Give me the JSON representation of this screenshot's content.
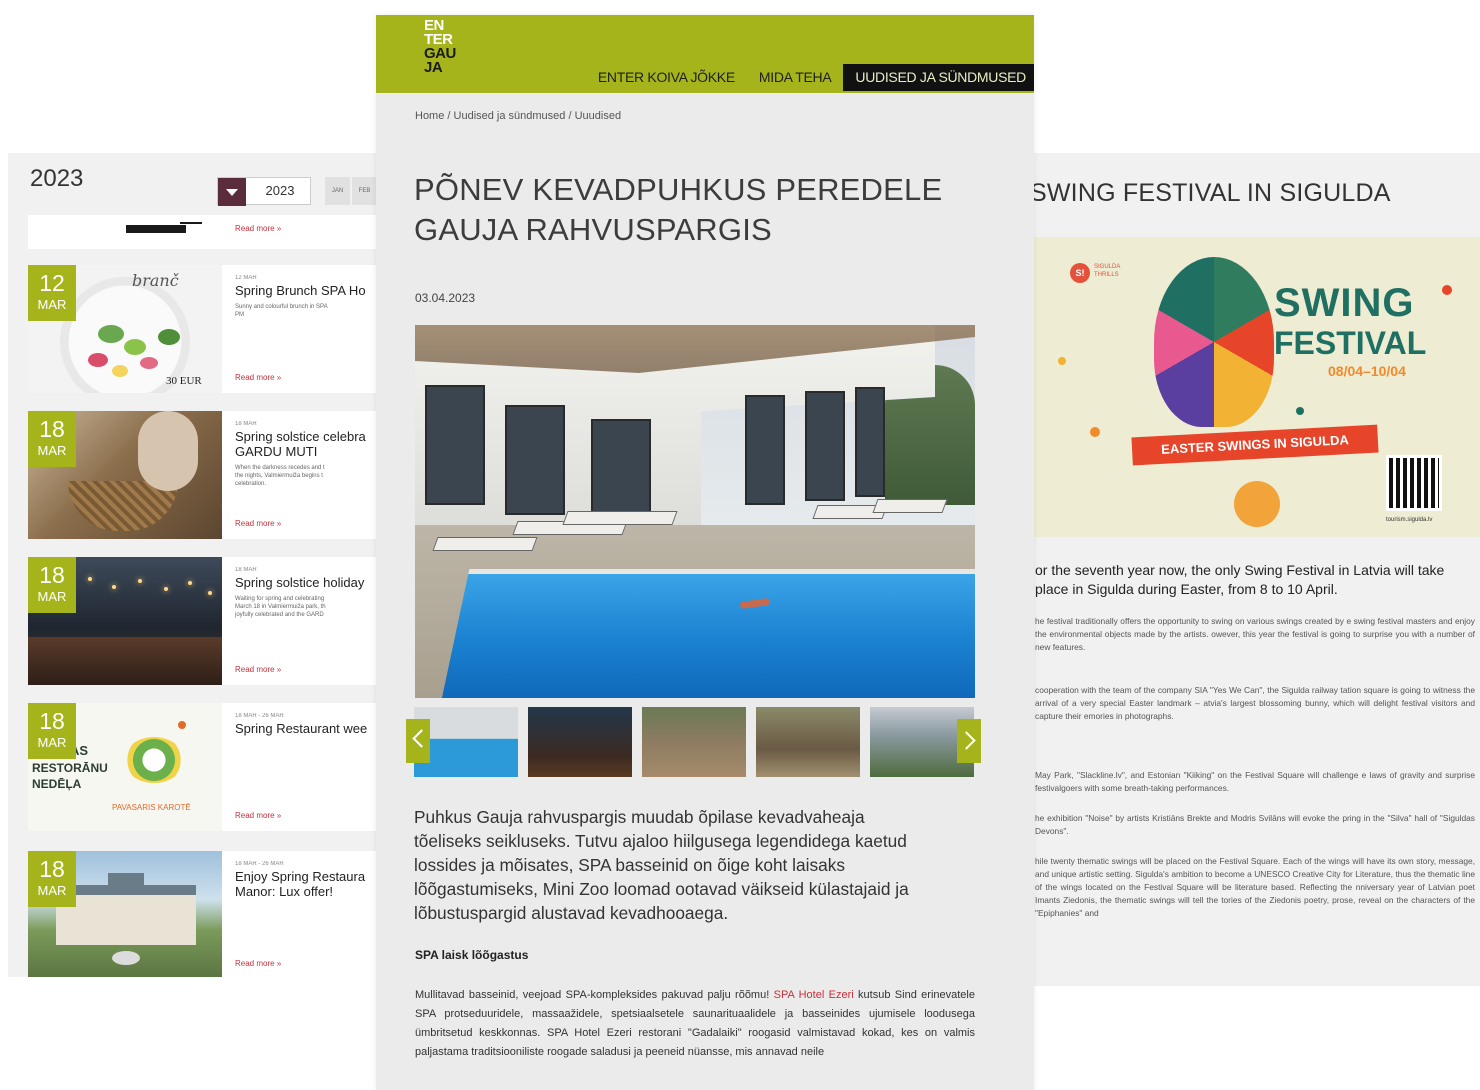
{
  "left": {
    "year_title": "2023",
    "year_select_value": "2023",
    "months": [
      "JAN",
      "FEB"
    ],
    "top_read_more": "Read more »",
    "events": [
      {
        "day": "12",
        "month": "MAR",
        "small_date": "12 MAR",
        "title": "Spring Brunch SPA Ho",
        "desc": "Sunny and colourful brunch in SPA",
        "desc2": "PM",
        "desc3": "",
        "read_more": "Read more »",
        "img_text": "branč",
        "price": "30 EUR"
      },
      {
        "day": "18",
        "month": "MAR",
        "small_date": "18 MAR",
        "title": "Spring solstice celebra",
        "title2": "GARDU MUTI",
        "desc": "When the darkness recedes and t",
        "desc2": "the nights, Valmiermuiža begins t",
        "desc3": "celebration.",
        "read_more": "Read more »"
      },
      {
        "day": "18",
        "month": "MAR",
        "small_date": "18 MAR",
        "title": "Spring solstice holiday",
        "desc": "Waiting for spring and celebrating",
        "desc2": "March 18 in Valmiermuiža park, th",
        "desc3": "joyfully celebrated and the GARD",
        "read_more": "Read more »"
      },
      {
        "day": "18",
        "month": "MAR",
        "small_date": "18 MAR - 26 MAR",
        "title": "Spring Restaurant wee",
        "desc": "",
        "desc2": "",
        "desc3": "",
        "read_more": "Read more »",
        "img_line1": "AS",
        "img_line2": "RESTORĀNU",
        "img_line3": "NEDĒĻA",
        "img_line4": "PAVASARIS KAROTĒ"
      },
      {
        "day": "18",
        "month": "MAR",
        "small_date": "18 MAR - 26 MAR",
        "title": "Enjoy Spring Restaura",
        "title2": "Manor: Lux offer!",
        "desc": "",
        "desc2": "",
        "desc3": "",
        "read_more": "Read more »"
      }
    ]
  },
  "center": {
    "logo_lines": [
      "EN",
      "TER",
      "GAU",
      "JA"
    ],
    "nav": [
      "ENTER KOIVA JÕKKE",
      "MIDA TEHA",
      "UUDISED JA SÜNDMUSED"
    ],
    "breadcrumb": "Home / Uudised ja sündmused / Uuudised",
    "title": "PÕNEV KEVADPUHKUS PEREDELE GAUJA RAHVUSPARGIS",
    "date": "03.04.2023",
    "lead": "Puhkus Gauja rahvuspargis muudab õpilase kevadvaheaja tõeliseks seikluseks. Tutvu ajaloo hiilgusega legendidega kaetud lossides ja mõisates, SPA basseinid on õige koht laisaks lõõgastumiseks, Mini Zoo loomad ootavad väikseid külastajaid ja lõbustuspargid alustavad kevadhooaega.",
    "subhead": "SPA laisk lõõgastus",
    "body_pre": "Mullitavad basseinid, veejoad SPA-kompleksides pakuvad palju rõõmu! ",
    "body_link": "SPA Hotel Ezeri",
    "body_post": " kutsub Sind erinevatele SPA protseduuridele, massaažidele, spetsiaalsetele saunarituaalidele ja basseinides ujumisele loodusega ümbritsetud keskkonnas. SPA Hotel Ezeri restorani \"Gadalaiki\" roogasid valmistavad kokad, kes on valmis paljastama traditsiooniliste roogade saladusi ja peeneid nüansse, mis annavad neile"
  },
  "right": {
    "title": "SWING FESTIVAL IN SIGULDA",
    "poster": {
      "logo_mark": "S!",
      "logo_text": "SIGULDA THRILLS",
      "swing": "SWING",
      "festival": "FESTIVAL",
      "dates": "08/04–10/04",
      "banner": "EASTER SWINGS IN SIGULDA",
      "url": "tourism.sigulda.lv"
    },
    "lead": "or the seventh year now, the only Swing Festival in Latvia will take place in Sigulda during Easter, from 8 to 10 April.",
    "paragraphs": [
      "he festival traditionally offers the opportunity to swing on various swings created by e swing festival masters and enjoy the environmental objects made by the artists. owever, this year the festival is going to surprise you with a number of new features.",
      "cooperation with the team of the company SIA \"Yes We Can\", the Sigulda railway tation square is going to witness the arrival of a very special Easter landmark – atvia's largest blossoming bunny, which will delight festival visitors and capture their emories in photographs.",
      "May Park, \"Slackline.lv\", and Estonian \"Kiiking\" on the Festival Square will challenge e laws of gravity and surprise festivalgoers with some breath-taking performances.",
      "he exhibition \"Noise\" by artists Kristiāns Brekte and Modris Svilāns will evoke the pring in the \"Silva\" hall of \"Siguldas Devons\".",
      "hile twenty thematic swings will be placed on the Festival Square. Each of the wings will have its own story, message, and unique artistic setting. Sigulda's ambition to become a UNESCO Creative City for Literature, thus the thematic line of the wings located on the Festival Square will be literature based. Reflecting the nniversary year of Latvian poet Imants Ziedonis, the thematic swings will tell the tories of the Ziedonis poetry, prose, reveal on the characters of the \"Epiphanies\" and"
    ]
  },
  "colors": {
    "accent_green": "#a5b41a",
    "link_red": "#c8303b",
    "nav_active_bg": "#111111"
  }
}
